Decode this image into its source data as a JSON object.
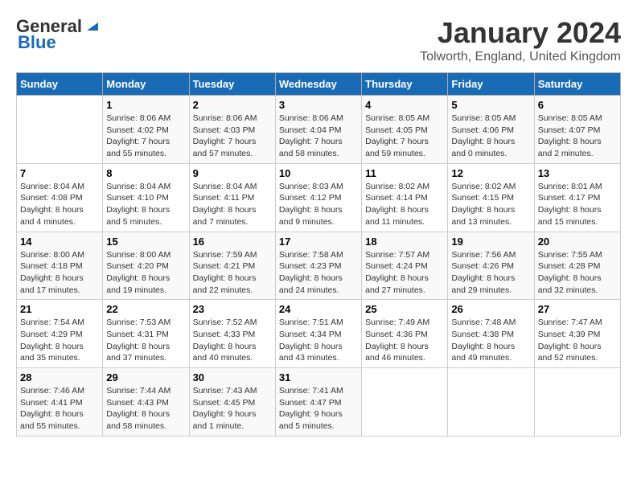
{
  "header": {
    "logo_line1": "General",
    "logo_line2": "Blue",
    "month": "January 2024",
    "location": "Tolworth, England, United Kingdom"
  },
  "days_of_week": [
    "Sunday",
    "Monday",
    "Tuesday",
    "Wednesday",
    "Thursday",
    "Friday",
    "Saturday"
  ],
  "weeks": [
    [
      {
        "day": "",
        "sunrise": "",
        "sunset": "",
        "daylight": ""
      },
      {
        "day": "1",
        "sunrise": "Sunrise: 8:06 AM",
        "sunset": "Sunset: 4:02 PM",
        "daylight": "Daylight: 7 hours and 55 minutes."
      },
      {
        "day": "2",
        "sunrise": "Sunrise: 8:06 AM",
        "sunset": "Sunset: 4:03 PM",
        "daylight": "Daylight: 7 hours and 57 minutes."
      },
      {
        "day": "3",
        "sunrise": "Sunrise: 8:06 AM",
        "sunset": "Sunset: 4:04 PM",
        "daylight": "Daylight: 7 hours and 58 minutes."
      },
      {
        "day": "4",
        "sunrise": "Sunrise: 8:05 AM",
        "sunset": "Sunset: 4:05 PM",
        "daylight": "Daylight: 7 hours and 59 minutes."
      },
      {
        "day": "5",
        "sunrise": "Sunrise: 8:05 AM",
        "sunset": "Sunset: 4:06 PM",
        "daylight": "Daylight: 8 hours and 0 minutes."
      },
      {
        "day": "6",
        "sunrise": "Sunrise: 8:05 AM",
        "sunset": "Sunset: 4:07 PM",
        "daylight": "Daylight: 8 hours and 2 minutes."
      }
    ],
    [
      {
        "day": "7",
        "sunrise": "Sunrise: 8:04 AM",
        "sunset": "Sunset: 4:08 PM",
        "daylight": "Daylight: 8 hours and 4 minutes."
      },
      {
        "day": "8",
        "sunrise": "Sunrise: 8:04 AM",
        "sunset": "Sunset: 4:10 PM",
        "daylight": "Daylight: 8 hours and 5 minutes."
      },
      {
        "day": "9",
        "sunrise": "Sunrise: 8:04 AM",
        "sunset": "Sunset: 4:11 PM",
        "daylight": "Daylight: 8 hours and 7 minutes."
      },
      {
        "day": "10",
        "sunrise": "Sunrise: 8:03 AM",
        "sunset": "Sunset: 4:12 PM",
        "daylight": "Daylight: 8 hours and 9 minutes."
      },
      {
        "day": "11",
        "sunrise": "Sunrise: 8:02 AM",
        "sunset": "Sunset: 4:14 PM",
        "daylight": "Daylight: 8 hours and 11 minutes."
      },
      {
        "day": "12",
        "sunrise": "Sunrise: 8:02 AM",
        "sunset": "Sunset: 4:15 PM",
        "daylight": "Daylight: 8 hours and 13 minutes."
      },
      {
        "day": "13",
        "sunrise": "Sunrise: 8:01 AM",
        "sunset": "Sunset: 4:17 PM",
        "daylight": "Daylight: 8 hours and 15 minutes."
      }
    ],
    [
      {
        "day": "14",
        "sunrise": "Sunrise: 8:00 AM",
        "sunset": "Sunset: 4:18 PM",
        "daylight": "Daylight: 8 hours and 17 minutes."
      },
      {
        "day": "15",
        "sunrise": "Sunrise: 8:00 AM",
        "sunset": "Sunset: 4:20 PM",
        "daylight": "Daylight: 8 hours and 19 minutes."
      },
      {
        "day": "16",
        "sunrise": "Sunrise: 7:59 AM",
        "sunset": "Sunset: 4:21 PM",
        "daylight": "Daylight: 8 hours and 22 minutes."
      },
      {
        "day": "17",
        "sunrise": "Sunrise: 7:58 AM",
        "sunset": "Sunset: 4:23 PM",
        "daylight": "Daylight: 8 hours and 24 minutes."
      },
      {
        "day": "18",
        "sunrise": "Sunrise: 7:57 AM",
        "sunset": "Sunset: 4:24 PM",
        "daylight": "Daylight: 8 hours and 27 minutes."
      },
      {
        "day": "19",
        "sunrise": "Sunrise: 7:56 AM",
        "sunset": "Sunset: 4:26 PM",
        "daylight": "Daylight: 8 hours and 29 minutes."
      },
      {
        "day": "20",
        "sunrise": "Sunrise: 7:55 AM",
        "sunset": "Sunset: 4:28 PM",
        "daylight": "Daylight: 8 hours and 32 minutes."
      }
    ],
    [
      {
        "day": "21",
        "sunrise": "Sunrise: 7:54 AM",
        "sunset": "Sunset: 4:29 PM",
        "daylight": "Daylight: 8 hours and 35 minutes."
      },
      {
        "day": "22",
        "sunrise": "Sunrise: 7:53 AM",
        "sunset": "Sunset: 4:31 PM",
        "daylight": "Daylight: 8 hours and 37 minutes."
      },
      {
        "day": "23",
        "sunrise": "Sunrise: 7:52 AM",
        "sunset": "Sunset: 4:33 PM",
        "daylight": "Daylight: 8 hours and 40 minutes."
      },
      {
        "day": "24",
        "sunrise": "Sunrise: 7:51 AM",
        "sunset": "Sunset: 4:34 PM",
        "daylight": "Daylight: 8 hours and 43 minutes."
      },
      {
        "day": "25",
        "sunrise": "Sunrise: 7:49 AM",
        "sunset": "Sunset: 4:36 PM",
        "daylight": "Daylight: 8 hours and 46 minutes."
      },
      {
        "day": "26",
        "sunrise": "Sunrise: 7:48 AM",
        "sunset": "Sunset: 4:38 PM",
        "daylight": "Daylight: 8 hours and 49 minutes."
      },
      {
        "day": "27",
        "sunrise": "Sunrise: 7:47 AM",
        "sunset": "Sunset: 4:39 PM",
        "daylight": "Daylight: 8 hours and 52 minutes."
      }
    ],
    [
      {
        "day": "28",
        "sunrise": "Sunrise: 7:46 AM",
        "sunset": "Sunset: 4:41 PM",
        "daylight": "Daylight: 8 hours and 55 minutes."
      },
      {
        "day": "29",
        "sunrise": "Sunrise: 7:44 AM",
        "sunset": "Sunset: 4:43 PM",
        "daylight": "Daylight: 8 hours and 58 minutes."
      },
      {
        "day": "30",
        "sunrise": "Sunrise: 7:43 AM",
        "sunset": "Sunset: 4:45 PM",
        "daylight": "Daylight: 9 hours and 1 minute."
      },
      {
        "day": "31",
        "sunrise": "Sunrise: 7:41 AM",
        "sunset": "Sunset: 4:47 PM",
        "daylight": "Daylight: 9 hours and 5 minutes."
      },
      {
        "day": "",
        "sunrise": "",
        "sunset": "",
        "daylight": ""
      },
      {
        "day": "",
        "sunrise": "",
        "sunset": "",
        "daylight": ""
      },
      {
        "day": "",
        "sunrise": "",
        "sunset": "",
        "daylight": ""
      }
    ]
  ]
}
